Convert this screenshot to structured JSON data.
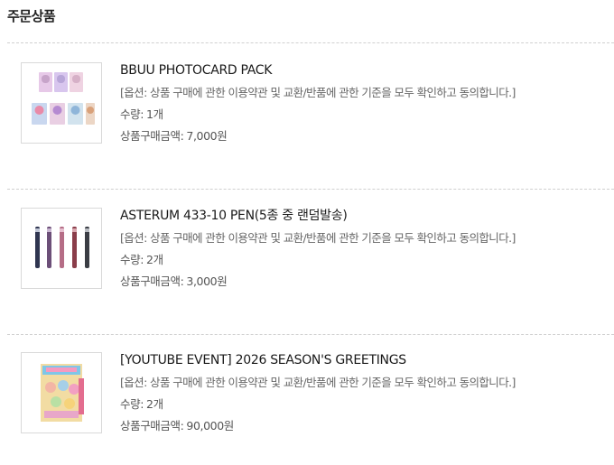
{
  "section": {
    "title": "주문상품"
  },
  "items": [
    {
      "name": "BBUU PHOTOCARD PACK",
      "option": "[옵션: 상품 구매에 관한 이용약관 및 교환/반품에 관한 기준을 모두 확인하고 동의합니다.]",
      "qty_label": "수량:",
      "qty": "1개",
      "price_label": "상품구매금액:",
      "price": "7,000원",
      "thumb_icon": "photocard-pack-image"
    },
    {
      "name": "ASTERUM 433-10 PEN(5종 중 랜덤발송)",
      "option": "[옵션: 상품 구매에 관한 이용약관 및 교환/반품에 관한 기준을 모두 확인하고 동의합니다.]",
      "qty_label": "수량:",
      "qty": "2개",
      "price_label": "상품구매금액:",
      "price": "3,000원",
      "thumb_icon": "pen-set-image"
    },
    {
      "name": "[YOUTUBE EVENT] 2026 SEASON'S GREETINGS",
      "option": "[옵션: 상품 구매에 관한 이용약관 및 교환/반품에 관한 기준을 모두 확인하고 동의합니다.]",
      "qty_label": "수량:",
      "qty": "2개",
      "price_label": "상품구매금액:",
      "price": "90,000원",
      "thumb_icon": "seasons-greetings-image"
    }
  ]
}
